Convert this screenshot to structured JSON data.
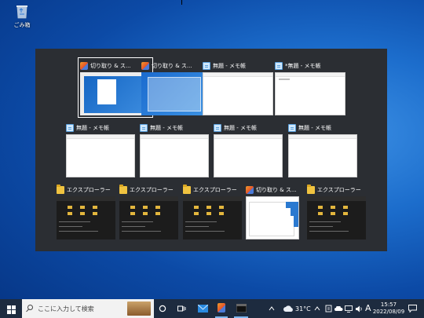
{
  "desktop": {
    "recycle_label": "ごみ箱"
  },
  "switcher": {
    "rows": [
      [
        {
          "title": "切り取り & ス...",
          "icon": "snipping-tool-icon",
          "thumb": "snip1",
          "selected": true
        },
        {
          "title": "切り取り & ス...",
          "icon": "snipping-tool-icon",
          "thumb": "snip2",
          "selected": false
        },
        {
          "title": "無題 - メモ帳",
          "icon": "notepad-icon",
          "thumb": "white",
          "selected": false
        },
        {
          "title": "*無題 - メモ帳",
          "icon": "notepad-icon",
          "thumb": "white",
          "selected": false
        }
      ],
      [
        {
          "title": "無題 - メモ帳",
          "icon": "notepad-icon",
          "thumb": "white"
        },
        {
          "title": "無題 - メモ帳",
          "icon": "notepad-icon",
          "thumb": "white"
        },
        {
          "title": "無題 - メモ帳",
          "icon": "notepad-icon",
          "thumb": "white"
        },
        {
          "title": "無題 - メモ帳",
          "icon": "notepad-icon",
          "thumb": "white"
        }
      ],
      [
        {
          "title": "エクスプローラー",
          "icon": "folder-icon",
          "thumb": "exp"
        },
        {
          "title": "エクスプローラー",
          "icon": "folder-icon",
          "thumb": "exp"
        },
        {
          "title": "エクスプローラー",
          "icon": "folder-icon",
          "thumb": "exp"
        },
        {
          "title": "切り取り & ス...",
          "icon": "snipping-tool-icon",
          "thumb": "snip3"
        },
        {
          "title": "エクスプローラー",
          "icon": "folder-icon",
          "thumb": "exp"
        }
      ]
    ]
  },
  "taskbar": {
    "search_placeholder": "ここに入力して検索",
    "weather_temp": "31°C",
    "ime_mode": "A",
    "time": "15:57",
    "date": "2022/08/09",
    "accent": "#1d2b3f"
  }
}
